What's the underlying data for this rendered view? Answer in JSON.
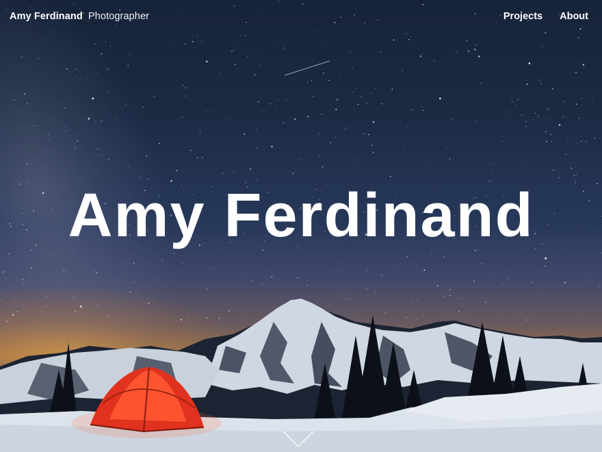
{
  "header": {
    "brand_name": "Amy Ferdinand",
    "brand_role": "Photographer",
    "nav": [
      {
        "label": "Projects"
      },
      {
        "label": "About"
      }
    ]
  },
  "hero": {
    "title": "Amy Ferdinand",
    "background_image": "night sky with milky way over snowy mountain and glowing red tent",
    "scroll_icon": "chevron-down-icon"
  },
  "colors": {
    "text": "#ffffff",
    "tent": "#e0321e",
    "sky_top": "#16233a",
    "horizon_glow": "#a07548",
    "snow": "#d9e0ea"
  }
}
